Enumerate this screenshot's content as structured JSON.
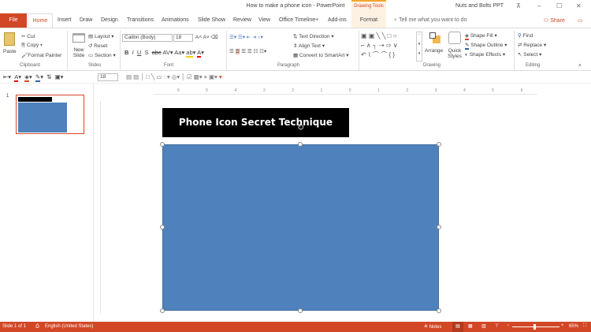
{
  "window": {
    "title": "How to make a phone icon  -  PowerPoint",
    "context_tab_group": "Drawing Tools",
    "user": "Nuts and Bolts PPT"
  },
  "tabs": [
    "File",
    "Home",
    "Insert",
    "Draw",
    "Design",
    "Transitions",
    "Animations",
    "Slide Show",
    "Review",
    "View",
    "Office Timeline+",
    "Add-ins",
    "Format"
  ],
  "tell_me": "Tell me what you want to do",
  "share": "Share",
  "ribbon": {
    "clipboard": {
      "label": "Clipboard",
      "paste": "Paste",
      "cut": "Cut",
      "copy": "Copy",
      "format_painter": "Format Painter"
    },
    "slides": {
      "label": "Slides",
      "new_slide": "New Slide",
      "layout": "Layout",
      "reset": "Reset",
      "section": "Section"
    },
    "font": {
      "label": "Font",
      "font_name": "Calibri (Body)",
      "font_size": "18"
    },
    "paragraph": {
      "label": "Paragraph",
      "text_direction": "Text Direction",
      "align_text": "Align Text",
      "convert_smartart": "Convert to SmartArt"
    },
    "drawing": {
      "label": "Drawing",
      "arrange": "Arrange",
      "quick_styles": "Quick Styles",
      "shape_fill": "Shape Fill",
      "shape_outline": "Shape Outline",
      "shape_effects": "Shape Effects"
    },
    "editing": {
      "label": "Editing",
      "find": "Find",
      "replace": "Replace",
      "select": "Select"
    }
  },
  "quick_toolbar": {
    "font_size": "18"
  },
  "ruler": [
    "6",
    "5",
    "4",
    "3",
    "2",
    "1",
    "0",
    "1",
    "2",
    "3",
    "4",
    "5",
    "6"
  ],
  "thumbnails": [
    {
      "number": "1"
    }
  ],
  "slide": {
    "title": "Phone Icon Secret Technique",
    "shape_color": "#4f81bd"
  },
  "status": {
    "slide": "Slide 1 of 1",
    "language": "English (United States)",
    "notes": "Notes",
    "zoom": "65%",
    "zoom_level": 65
  }
}
